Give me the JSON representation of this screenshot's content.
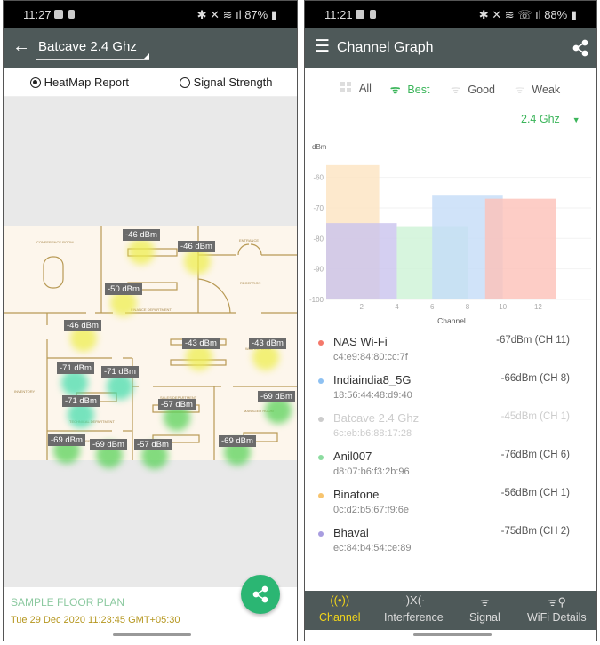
{
  "left": {
    "status": {
      "time": "11:27",
      "battery": "87%"
    },
    "network_selector": "Batcave 2.4 Ghz",
    "radio_options": [
      {
        "label": "HeatMap Report",
        "selected": true
      },
      {
        "label": "Signal Strength",
        "selected": false
      }
    ],
    "rooms": [
      "CONFERENCE ROOM",
      "ENTRANCE",
      "RECEPTION",
      "FINANCE DEPARTMENT",
      "INVENTORY",
      "WAITING AREA",
      "TECHNICAL DEPARTMENT",
      "SALES DEPARTMENT",
      "MANAGER ROOM",
      "STORE ROOM"
    ],
    "readings": [
      "-46 dBm",
      "-46 dBm",
      "-50 dBm",
      "-46 dBm",
      "-43 dBm",
      "-43 dBm",
      "-71 dBm",
      "-71 dBm",
      "-71 dBm",
      "-57 dBm",
      "-69 dBm",
      "-69 dBm",
      "-69 dBm",
      "-57 dBm",
      "-69 dBm"
    ],
    "footer": {
      "title": "SAMPLE FLOOR PLAN",
      "date": "Tue 29 Dec 2020 11:23:45 GMT+05:30"
    },
    "share_icon": "share-icon"
  },
  "right": {
    "status": {
      "time": "11:21",
      "battery": "88%"
    },
    "title": "Channel Graph",
    "filters": [
      {
        "label": "All",
        "icon": "grid-icon",
        "active": false
      },
      {
        "label": "Best",
        "icon": "wifi-full-icon",
        "active": true
      },
      {
        "label": "Good",
        "icon": "wifi-mid-icon",
        "active": false
      },
      {
        "label": "Weak",
        "icon": "wifi-low-icon",
        "active": false
      }
    ],
    "band": "2.4 Ghz",
    "networks": [
      {
        "name": "NAS Wi-Fi",
        "mac": "c4:e9:84:80:cc:7f",
        "signal": "-67dBm (CH 11)",
        "color": "#f4786a",
        "hidden": false
      },
      {
        "name": "Indiaindia8_5G",
        "mac": "18:56:44:48:d9:40",
        "signal": "-66dBm (CH 8)",
        "color": "#8ec1f2",
        "hidden": false
      },
      {
        "name": "Batcave 2.4 Ghz",
        "mac": "6c:eb:b6:88:17:28",
        "signal": "-45dBm (CH 1)",
        "color": "#cccccc",
        "hidden": true
      },
      {
        "name": "Anil007",
        "mac": "d8:07:b6:f3:2b:96",
        "signal": "-76dBm (CH 6)",
        "color": "#8cdca0",
        "hidden": false
      },
      {
        "name": "Binatone",
        "mac": "0c:d2:b5:67:f9:6e",
        "signal": "-56dBm (CH 1)",
        "color": "#f7c46e",
        "hidden": false
      },
      {
        "name": "Bhaval",
        "mac": "ec:84:b4:54:ce:89",
        "signal": "-75dBm (CH 2)",
        "color": "#a89de0",
        "hidden": false
      }
    ],
    "bottom_nav": [
      {
        "label": "Channel",
        "active": true
      },
      {
        "label": "Interference",
        "active": false
      },
      {
        "label": "Signal",
        "active": false
      },
      {
        "label": "WiFi Details",
        "active": false
      }
    ]
  },
  "chart_data": {
    "type": "bar",
    "ylabel": "dBm",
    "xlabel": "Channel",
    "ylim": [
      -100,
      -54
    ],
    "xlim": [
      0,
      15
    ],
    "yticks": [
      -60,
      -70,
      -80,
      -90,
      -100
    ],
    "xticks": [
      2,
      4,
      6,
      8,
      10,
      12
    ],
    "grid": true,
    "series": [
      {
        "name": "Binatone",
        "x_start": 0,
        "x_end": 3,
        "value": -56,
        "color": "#fde3c0"
      },
      {
        "name": "Bhaval",
        "x_start": 0,
        "x_end": 4,
        "value": -75,
        "color": "#c9c3ee"
      },
      {
        "name": "Anil007",
        "x_start": 4,
        "x_end": 8,
        "value": -76,
        "color": "#cdf2d6"
      },
      {
        "name": "Indiaindia8_5G",
        "x_start": 6,
        "x_end": 10,
        "value": -66,
        "color": "#c4dcf8"
      },
      {
        "name": "NAS Wi-Fi",
        "x_start": 9,
        "x_end": 13,
        "value": -67,
        "color": "#fcc0b8"
      }
    ]
  }
}
